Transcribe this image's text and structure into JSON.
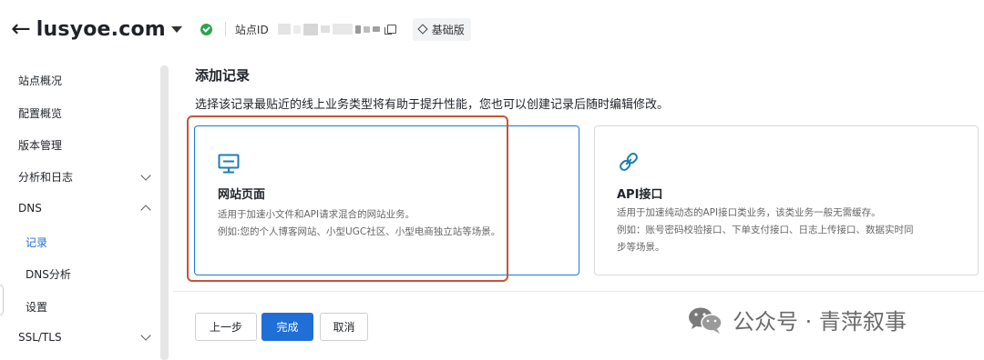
{
  "header": {
    "domain": "lusyoe.com",
    "site_id_label": "站点ID",
    "plan_label": "基础版"
  },
  "sidebar": {
    "items": [
      {
        "label": "站点概况"
      },
      {
        "label": "配置概览"
      },
      {
        "label": "版本管理"
      },
      {
        "label": "分析和日志"
      },
      {
        "label": "DNS"
      },
      {
        "label": "记录"
      },
      {
        "label": "DNS分析"
      },
      {
        "label": "设置"
      },
      {
        "label": "SSL/TLS"
      }
    ]
  },
  "main": {
    "title": "添加记录",
    "description": "选择该记录最贴近的线上业务类型将有助于提升性能，您也可以创建记录后随时编辑修改。",
    "cards": [
      {
        "title": "网站页面",
        "line1": "适用于加速小文件和API请求混合的网站业务。",
        "line2": "例如:您的个人博客网站、小型UGC社区、小型电商独立站等场景。",
        "icon": "monitor-icon"
      },
      {
        "title": "API接口",
        "line1": "适用于加速纯动态的API接口类业务，该类业务一般无需缓存。",
        "line2": "例如：账号密码校验接口、下单支付接口、日志上传接口、数据实时同",
        "line3": "步等场景。",
        "icon": "link-icon"
      }
    ],
    "buttons": {
      "prev": "上一步",
      "done": "完成",
      "cancel": "取消"
    }
  },
  "watermark": {
    "text": "公众号 · 青萍叙事"
  },
  "colors": {
    "primary": "#1f6fd6",
    "highlight": "#c6543a",
    "success": "#2da44e"
  }
}
